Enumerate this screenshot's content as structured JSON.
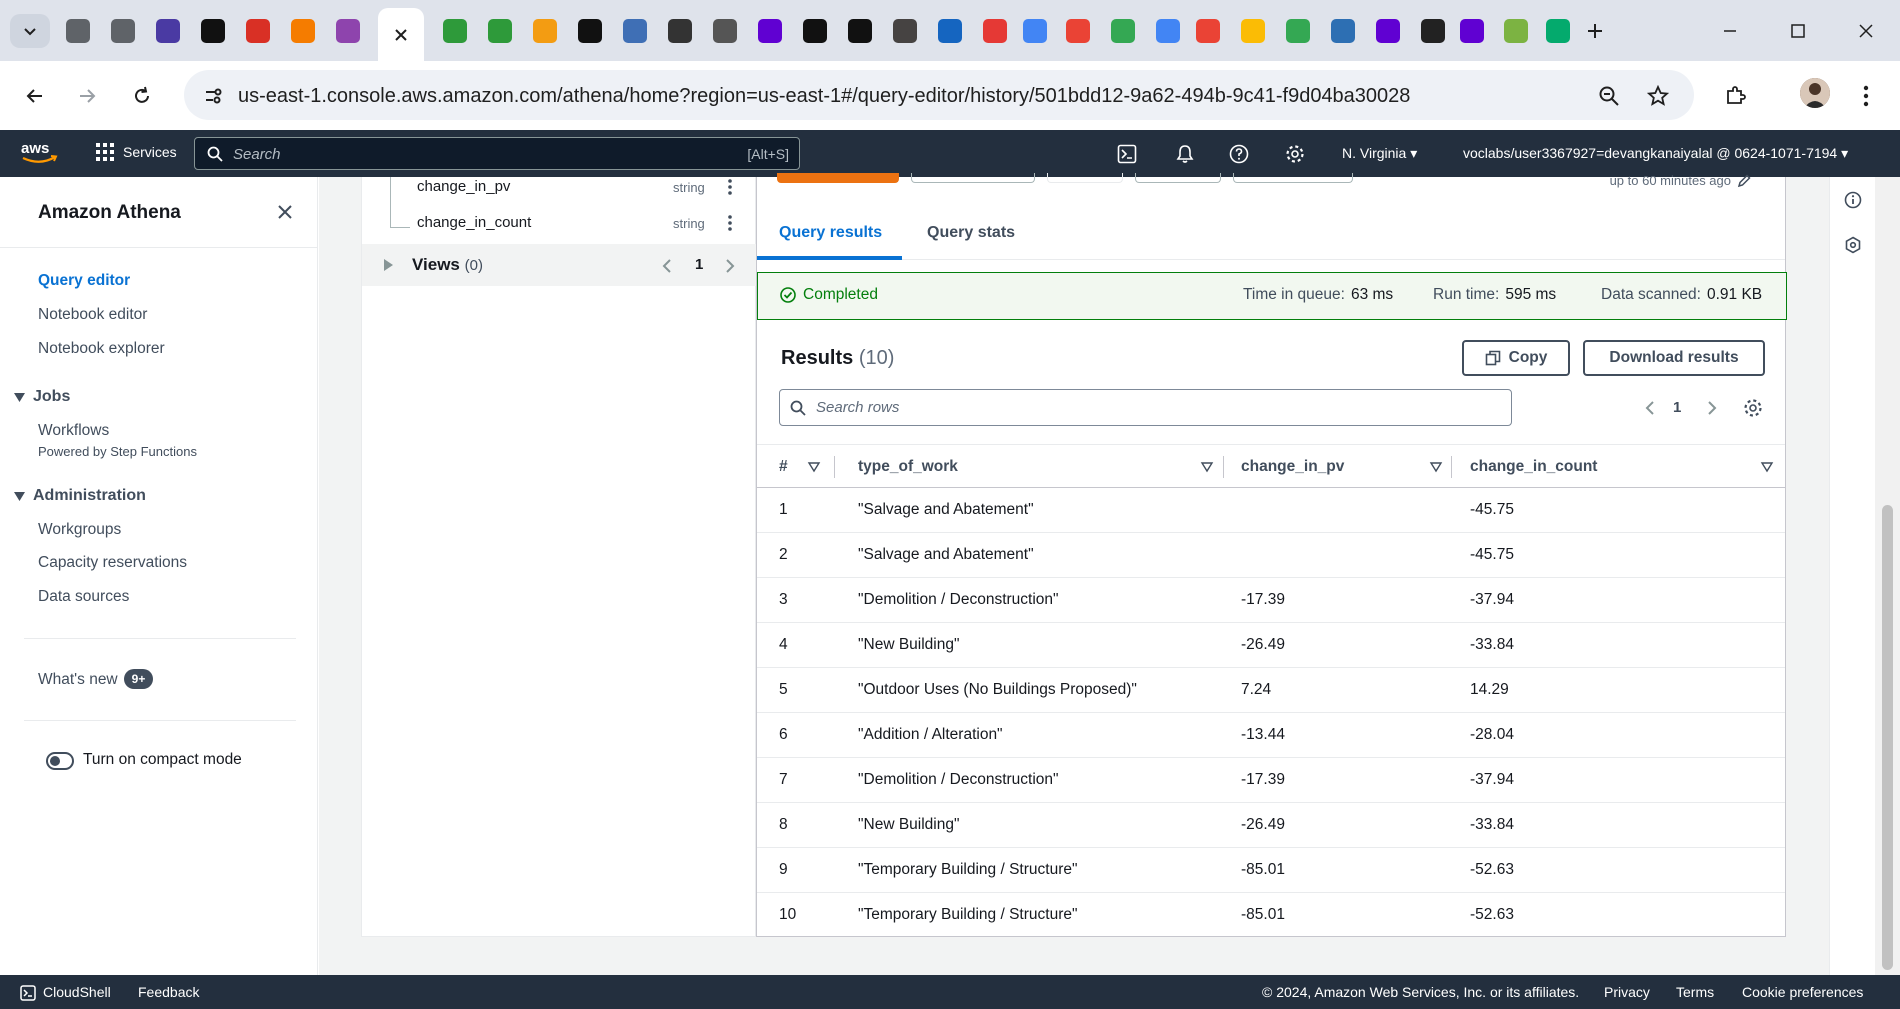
{
  "browser": {
    "url": "us-east-1.console.aws.amazon.com/athena/home?region=us-east-1#/query-editor/history/501bdd12-9a62-494b-9c41-f9d04ba30028",
    "tabs": [
      {
        "icon": "globe-icon",
        "color": "#5f6368"
      },
      {
        "icon": "globe-icon",
        "color": "#5f6368"
      },
      {
        "icon": "mail-icon",
        "color": "#4a3aa3"
      },
      {
        "icon": "d2l-icon",
        "color": "#111111"
      },
      {
        "icon": "gear-flower-icon",
        "color": "#d93025"
      },
      {
        "icon": "box-icon",
        "color": "#f57c00"
      },
      {
        "icon": "funnel-icon",
        "color": "#8e44ad"
      },
      {
        "icon": "sheet-icon",
        "color": "#2e9a3a"
      },
      {
        "icon": "sheet-icon",
        "color": "#2e9a3a"
      },
      {
        "icon": "circles-icon",
        "color": "#f39c12"
      },
      {
        "icon": "d2l-icon",
        "color": "#111111"
      },
      {
        "icon": "list-icon",
        "color": "#3f6fb5"
      },
      {
        "icon": "spiral-icon",
        "color": "#333333"
      },
      {
        "icon": "bee-icon",
        "color": "#555555"
      },
      {
        "icon": "yahoo-icon",
        "color": "#6001d2"
      },
      {
        "icon": "d2l-icon",
        "color": "#111111"
      },
      {
        "icon": "d2l-icon",
        "color": "#111111"
      },
      {
        "icon": "wordpress-icon",
        "color": "#464342"
      },
      {
        "icon": "sql-icon",
        "color": "#1565c0"
      },
      {
        "icon": "co-icon",
        "color": "#e53935"
      },
      {
        "icon": "google-icon",
        "color": "#4285f4"
      },
      {
        "icon": "one-icon",
        "color": "#ea4335"
      },
      {
        "icon": "drive-icon",
        "color": "#34a853"
      },
      {
        "icon": "google-icon",
        "color": "#4285f4"
      },
      {
        "icon": "one-icon",
        "color": "#ea4335"
      },
      {
        "icon": "pinwheel-icon",
        "color": "#fbbc05"
      },
      {
        "icon": "drive-icon",
        "color": "#34a853"
      },
      {
        "icon": "globe-icon",
        "color": "#2d6fb3"
      },
      {
        "icon": "yahoo-icon",
        "color": "#6001d2"
      },
      {
        "icon": "openai-icon",
        "color": "#222222"
      },
      {
        "icon": "yahoo-icon",
        "color": "#6001d2"
      },
      {
        "icon": "plant-icon",
        "color": "#7cb342"
      },
      {
        "icon": "w3-icon",
        "color": "#04aa6d"
      }
    ]
  },
  "awsnav": {
    "services_label": "Services",
    "search_placeholder": "Search",
    "search_shortcut": "[Alt+S]",
    "region": "N. Virginia",
    "account": "voclabs/user3367927=devangkanaiyalal @ 0624-1071-7194"
  },
  "sidenav": {
    "title": "Amazon Athena",
    "links": [
      "Query editor",
      "Notebook editor",
      "Notebook explorer"
    ],
    "jobs_section": "Jobs",
    "workflows": "Workflows",
    "workflows_sub": "Powered by Step Functions",
    "admin_section": "Administration",
    "admin_links": [
      "Workgroups",
      "Capacity reservations",
      "Data sources"
    ],
    "whats_new": "What's new",
    "whats_new_badge": "9+",
    "compact_mode": "Turn on compact mode"
  },
  "schema": {
    "columns": [
      {
        "name": "change_in_pv",
        "type": "string"
      },
      {
        "name": "change_in_count",
        "type": "string"
      }
    ],
    "views_label": "Views",
    "views_count": "(0)",
    "views_page": "1"
  },
  "results": {
    "updated_note": "up to 60 minutes ago",
    "tab_results": "Query results",
    "tab_stats": "Query stats",
    "status": "Completed",
    "time_in_queue_label": "Time in queue:",
    "time_in_queue": "63 ms",
    "run_time_label": "Run time:",
    "run_time": "595 ms",
    "data_scanned_label": "Data scanned:",
    "data_scanned": "0.91 KB",
    "heading": "Results",
    "count": "(10)",
    "copy_label": "Copy",
    "download_label": "Download results",
    "search_placeholder": "Search rows",
    "page": "1",
    "headers": [
      "#",
      "type_of_work",
      "change_in_pv",
      "change_in_count"
    ],
    "rows": [
      [
        "1",
        "\"Salvage and Abatement\"",
        "",
        "-45.75"
      ],
      [
        "2",
        "\"Salvage and Abatement\"",
        "",
        "-45.75"
      ],
      [
        "3",
        "\"Demolition / Deconstruction\"",
        "-17.39",
        "-37.94"
      ],
      [
        "4",
        "\"New Building\"",
        "-26.49",
        "-33.84"
      ],
      [
        "5",
        "\"Outdoor Uses (No Buildings Proposed)\"",
        "7.24",
        "14.29"
      ],
      [
        "6",
        "\"Addition / Alteration\"",
        "-13.44",
        "-28.04"
      ],
      [
        "7",
        "\"Demolition / Deconstruction\"",
        "-17.39",
        "-37.94"
      ],
      [
        "8",
        "\"New Building\"",
        "-26.49",
        "-33.84"
      ],
      [
        "9",
        "\"Temporary Building / Structure\"",
        "-85.01",
        "-52.63"
      ],
      [
        "10",
        "\"Temporary Building / Structure\"",
        "-85.01",
        "-52.63"
      ]
    ]
  },
  "footer": {
    "cloudshell": "CloudShell",
    "feedback": "Feedback",
    "copyright": "© 2024, Amazon Web Services, Inc. or its affiliates.",
    "privacy": "Privacy",
    "terms": "Terms",
    "cookies": "Cookie preferences"
  },
  "colors": {
    "aws_nav": "#232f3e",
    "link_blue": "#0972d3",
    "success_green": "#037f0c"
  }
}
